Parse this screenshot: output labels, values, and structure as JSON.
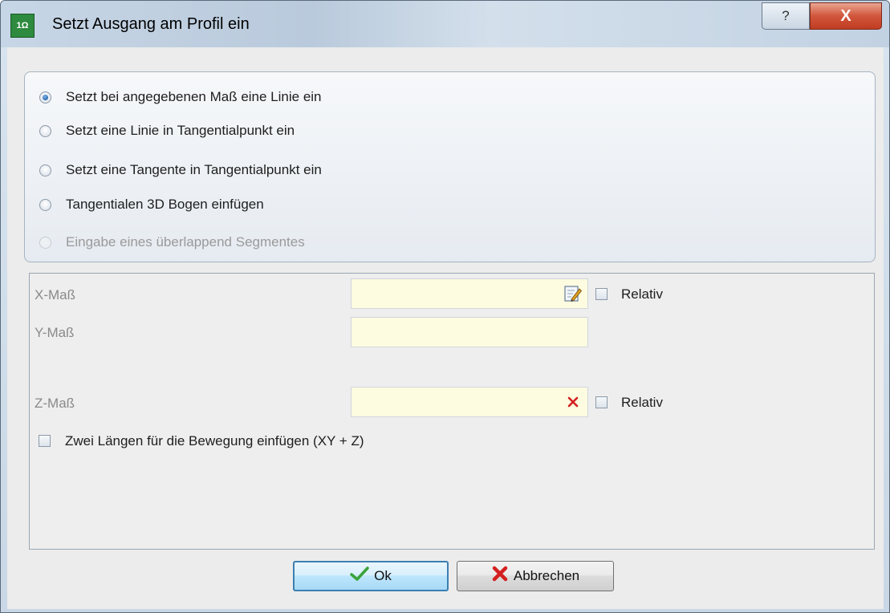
{
  "window": {
    "title": "Setzt Ausgang am Profil ein",
    "help_button": "?",
    "close_button": "X",
    "app_icon_text": "1Ω"
  },
  "options": [
    {
      "label": "Setzt bei angegebenen Maß eine Linie ein",
      "checked": true,
      "enabled": true
    },
    {
      "label": "Setzt eine Linie in Tangentialpunkt ein",
      "checked": false,
      "enabled": true
    },
    {
      "label": "Setzt eine Tangente in Tangentialpunkt ein",
      "checked": false,
      "enabled": true
    },
    {
      "label": "Tangentialen 3D Bogen einfügen",
      "checked": false,
      "enabled": true
    },
    {
      "label": "Eingabe eines überlappend Segmentes",
      "checked": false,
      "enabled": false
    }
  ],
  "fields": {
    "x": {
      "label": "X-Maß",
      "value": "",
      "relative_label": "Relativ"
    },
    "y": {
      "label": "Y-Maß",
      "value": ""
    },
    "z": {
      "label": "Z-Maß",
      "value": "",
      "relative_label": "Relativ"
    }
  },
  "two_lengths": {
    "label": "Zwei Längen für die Bewegung einfügen (XY + Z)",
    "checked": false
  },
  "buttons": {
    "ok": "Ok",
    "cancel": "Abbrechen"
  },
  "icons": {
    "edit": "edit-icon",
    "clear": "clear-icon",
    "ok": "checkmark-icon",
    "cancel": "cross-icon"
  },
  "colors": {
    "field_bg": "#fdfbe0",
    "ok_check": "#3aa33a",
    "cancel_cross": "#d42020"
  }
}
